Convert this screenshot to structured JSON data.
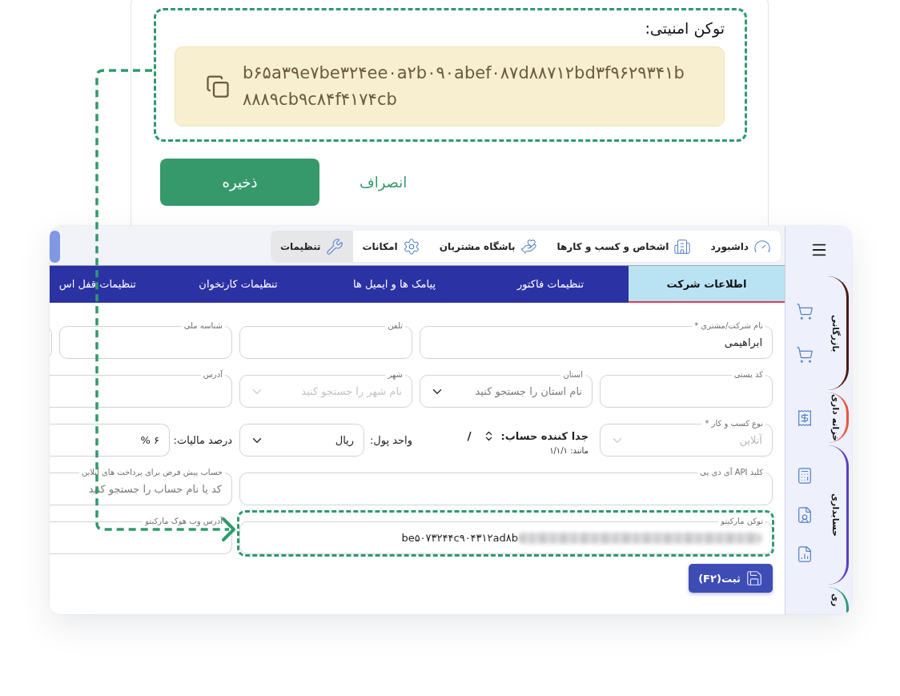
{
  "security_token": {
    "label": "توکن امنیتی:",
    "value": "b۶۵a۳۹e۷be۳۲۴ee۰a۲b۰۹۰abef۰۸۷d۸۸۷۱۲bd۳f۹۶۲۹۳۴۱b۸۸۸۹cb۹c۸۴f۴۱۷۴cb",
    "highlighted": true
  },
  "dialog_buttons": [
    {
      "label": "انصراف",
      "kind": "link"
    },
    {
      "label": "ذخیره",
      "kind": "primary"
    }
  ],
  "app": {
    "nav_items": [
      {
        "label": "داشبورد",
        "selected": false
      },
      {
        "label": "اشخاص و کسب و کارها",
        "selected": false
      },
      {
        "label": "باشگاه مشتریان",
        "selected": false
      },
      {
        "label": "امکانات",
        "selected": false
      },
      {
        "label": "تنظیمات",
        "selected": true
      }
    ],
    "tabs": [
      {
        "label": "اطلاعات شرکت",
        "selected": true
      },
      {
        "label": "تنظیمات فاکتور",
        "selected": false
      },
      {
        "label": "پیامک ها و ایمیل ها",
        "selected": false
      },
      {
        "label": "تنظیمات کارتخوان",
        "selected": false
      },
      {
        "label": "تنظیمات قفل اس",
        "selected": false
      }
    ],
    "form_rows": [
      [
        {
          "kind": "text",
          "label": "نام شرکت/مشتری *",
          "value": "ابراهیمی"
        },
        {
          "kind": "text",
          "label": "تلفن"
        },
        {
          "kind": "text",
          "label": "شناسه ملی"
        },
        {
          "kind": "text"
        }
      ],
      [
        {
          "kind": "text",
          "label": "کد پستی"
        },
        {
          "kind": "select",
          "label": "استان",
          "placeholder": "نام استان را جستجو کنید",
          "disabled": false
        },
        {
          "kind": "select",
          "label": "شهر",
          "placeholder": "نام شهر را جستجو کنید",
          "disabled": true
        },
        {
          "kind": "text",
          "label": "آدرس"
        }
      ],
      [
        {
          "kind": "select",
          "label": "نوع کسب و کار *",
          "value": "آنلاین",
          "disabled": true
        },
        {
          "kind": "separator",
          "label": "جدا کننده حساب:",
          "value": "/",
          "hint": "مانند: ۱/۱/۱"
        },
        {
          "kind": "inline-select",
          "label": "واحد پول:",
          "value": "ریال"
        },
        {
          "kind": "inline-input",
          "label": "درصد مالیات:",
          "value": "% ۶"
        }
      ],
      [
        {
          "kind": "text",
          "label": "کلید API آی دی پی"
        },
        {
          "kind": "text",
          "label": "حساب پیش فرض برای پرداخت های آنلاین",
          "placeholder": "کد یا نام حساب را جستجو کنید"
        }
      ],
      [
        {
          "kind": "token",
          "label": "توکن مارکیتو",
          "value": "be۵۰۷۳۲۴۴c۹۰۴۳۱۲ad۸b",
          "blurred": true,
          "highlighted": true
        },
        {
          "kind": "text",
          "label": "آدرس وب هوک مارکیتو"
        }
      ]
    ],
    "submit_button": {
      "label": "ثبت(F۲)"
    },
    "sidebar": {
      "sections": [
        {
          "label": "بازرگانی",
          "color": "#4a1a10"
        },
        {
          "label": "خزانه داری",
          "color": "#e8553a"
        },
        {
          "label": "حسابداری",
          "color": "#5b3fc0"
        },
        {
          "label": "ری",
          "color": "#2a9a78"
        }
      ]
    }
  }
}
